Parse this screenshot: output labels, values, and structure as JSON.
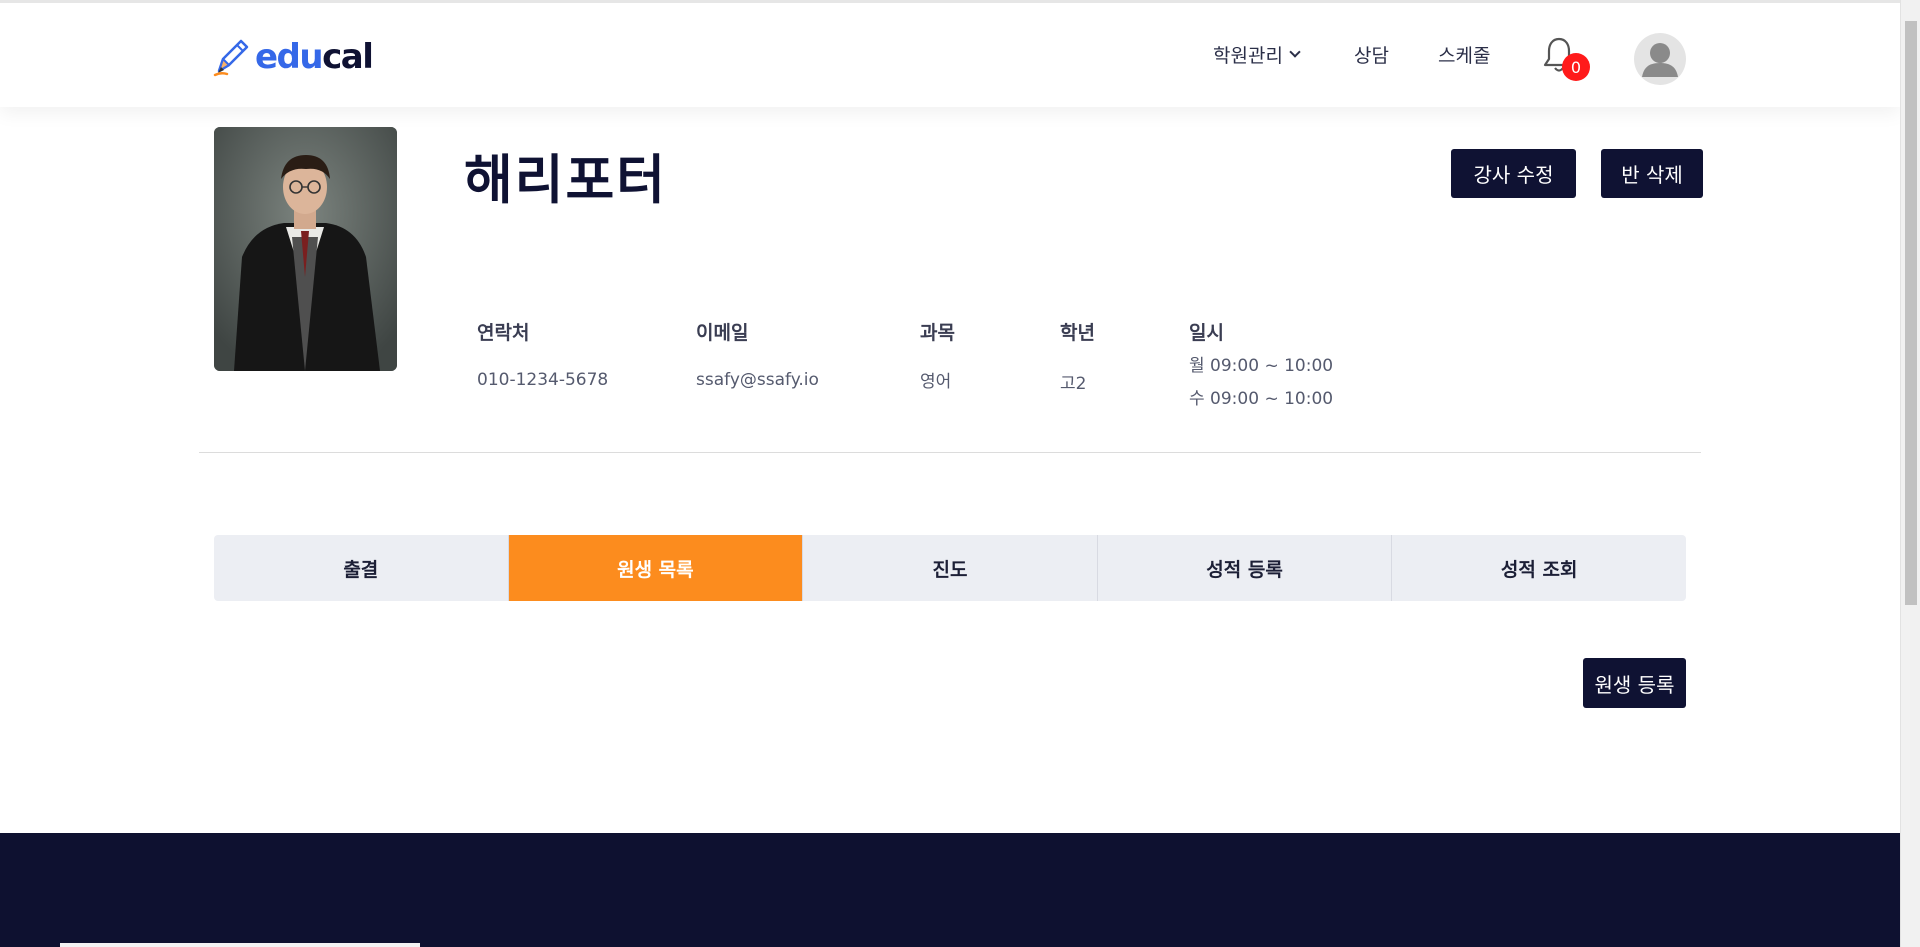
{
  "brand": {
    "part1": "edu",
    "part2": "cal"
  },
  "nav": {
    "academy_mgmt": "학원관리",
    "consult": "상담",
    "schedule": "스케줄",
    "notification_count": "0"
  },
  "profile": {
    "name": "해리포터",
    "edit_button": "강사 수정",
    "delete_button": "반 삭제",
    "fields": {
      "contact_label": "연락처",
      "contact_value": "010-1234-5678",
      "email_label": "이메일",
      "email_value": "ssafy@ssafy.io",
      "subject_label": "과목",
      "subject_value": "영어",
      "grade_label": "학년",
      "grade_value": "고2",
      "schedule_label": "일시",
      "schedule_line1": "월 09:00 ~ 10:00",
      "schedule_line2": "수 09:00 ~ 10:00"
    }
  },
  "tabs": [
    "출결",
    "원생 목록",
    "진도",
    "성적 등록",
    "성적 조회"
  ],
  "active_tab": "원생 목록",
  "register_button": "원생 등록",
  "colors": {
    "accent": "#fc8c1e",
    "dark": "#0f1233",
    "badge": "#ff1a1a",
    "logo_blue": "#3568e8"
  }
}
